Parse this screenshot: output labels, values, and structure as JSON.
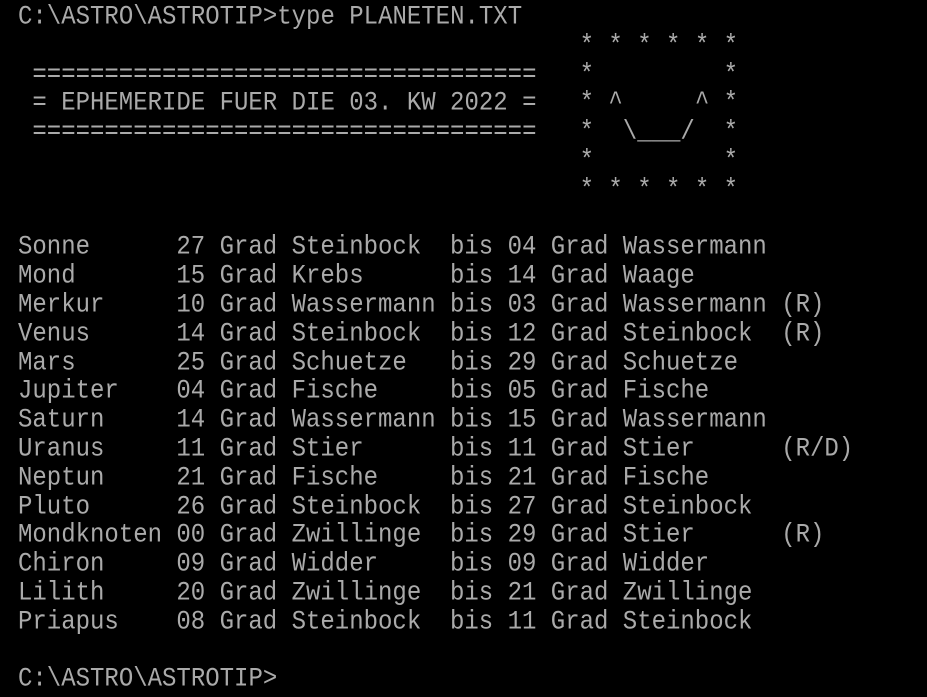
{
  "colors": {
    "background": "#000000",
    "text": "#aaaaaa"
  },
  "command_line": {
    "prompt": "C:\\ASTRO\\ASTROTIP>",
    "command": "type PLANETEN.TXT"
  },
  "header": {
    "rule": "===================================",
    "title": "= EPHEMERIDE FUER DIE 03. KW 2022 ="
  },
  "smiley_art": [
    "* * * * * *",
    "*         *",
    "* ^     ^ *",
    "*  \\___/  *",
    "*         *",
    "* * * * * *"
  ],
  "ephemeris": [
    {
      "body": "Sonne",
      "from_deg": "27",
      "unit": "Grad",
      "from_sign": "Steinbock",
      "sep": "bis",
      "to_deg": "04",
      "to_sign": "Wassermann",
      "note": ""
    },
    {
      "body": "Mond",
      "from_deg": "15",
      "unit": "Grad",
      "from_sign": "Krebs",
      "sep": "bis",
      "to_deg": "14",
      "to_sign": "Waage",
      "note": ""
    },
    {
      "body": "Merkur",
      "from_deg": "10",
      "unit": "Grad",
      "from_sign": "Wassermann",
      "sep": "bis",
      "to_deg": "03",
      "to_sign": "Wassermann",
      "note": "(R)"
    },
    {
      "body": "Venus",
      "from_deg": "14",
      "unit": "Grad",
      "from_sign": "Steinbock",
      "sep": "bis",
      "to_deg": "12",
      "to_sign": "Steinbock",
      "note": "(R)"
    },
    {
      "body": "Mars",
      "from_deg": "25",
      "unit": "Grad",
      "from_sign": "Schuetze",
      "sep": "bis",
      "to_deg": "29",
      "to_sign": "Schuetze",
      "note": ""
    },
    {
      "body": "Jupiter",
      "from_deg": "04",
      "unit": "Grad",
      "from_sign": "Fische",
      "sep": "bis",
      "to_deg": "05",
      "to_sign": "Fische",
      "note": ""
    },
    {
      "body": "Saturn",
      "from_deg": "14",
      "unit": "Grad",
      "from_sign": "Wassermann",
      "sep": "bis",
      "to_deg": "15",
      "to_sign": "Wassermann",
      "note": ""
    },
    {
      "body": "Uranus",
      "from_deg": "11",
      "unit": "Grad",
      "from_sign": "Stier",
      "sep": "bis",
      "to_deg": "11",
      "to_sign": "Stier",
      "note": "(R/D)"
    },
    {
      "body": "Neptun",
      "from_deg": "21",
      "unit": "Grad",
      "from_sign": "Fische",
      "sep": "bis",
      "to_deg": "21",
      "to_sign": "Fische",
      "note": ""
    },
    {
      "body": "Pluto",
      "from_deg": "26",
      "unit": "Grad",
      "from_sign": "Steinbock",
      "sep": "bis",
      "to_deg": "27",
      "to_sign": "Steinbock",
      "note": ""
    },
    {
      "body": "Mondknoten",
      "from_deg": "00",
      "unit": "Grad",
      "from_sign": "Zwillinge",
      "sep": "bis",
      "to_deg": "29",
      "to_sign": "Stier",
      "note": "(R)"
    },
    {
      "body": "Chiron",
      "from_deg": "09",
      "unit": "Grad",
      "from_sign": "Widder",
      "sep": "bis",
      "to_deg": "09",
      "to_sign": "Widder",
      "note": ""
    },
    {
      "body": "Lilith",
      "from_deg": "20",
      "unit": "Grad",
      "from_sign": "Zwillinge",
      "sep": "bis",
      "to_deg": "21",
      "to_sign": "Zwillinge",
      "note": ""
    },
    {
      "body": "Priapus",
      "from_deg": "08",
      "unit": "Grad",
      "from_sign": "Steinbock",
      "sep": "bis",
      "to_deg": "11",
      "to_sign": "Steinbock",
      "note": ""
    }
  ],
  "final_prompt": "C:\\ASTRO\\ASTROTIP>"
}
